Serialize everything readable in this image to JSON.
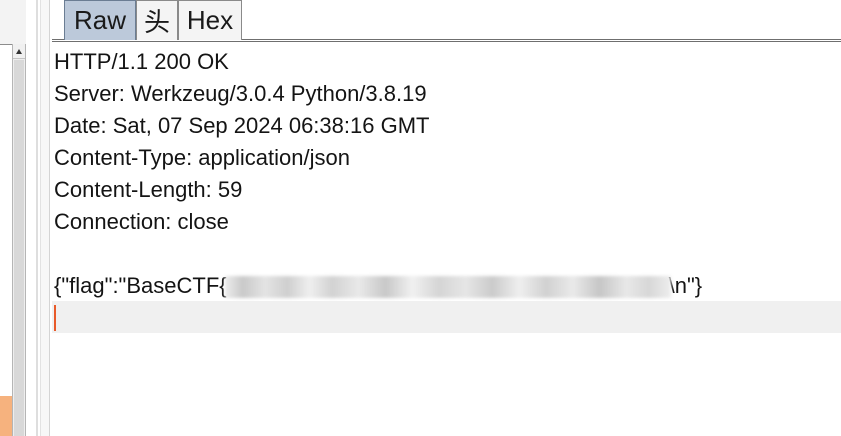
{
  "tabs": [
    {
      "label": "Raw",
      "active": true
    },
    {
      "label": "头",
      "active": false
    },
    {
      "label": "Hex",
      "active": false
    }
  ],
  "response": {
    "status_line": "HTTP/1.1 200 OK",
    "headers": [
      "Server: Werkzeug/3.0.4 Python/3.8.19",
      "Date: Sat, 07 Sep 2024 06:38:16 GMT",
      "Content-Type: application/json",
      "Content-Length: 59",
      "Connection: close"
    ],
    "body_prefix": "{\"flag\":\"BaseCTF{",
    "body_suffix": "\\n\"}"
  },
  "colors": {
    "active_tab": "#bcc9da",
    "caret": "#e85a2a",
    "current_line": "#f0f0f0"
  }
}
